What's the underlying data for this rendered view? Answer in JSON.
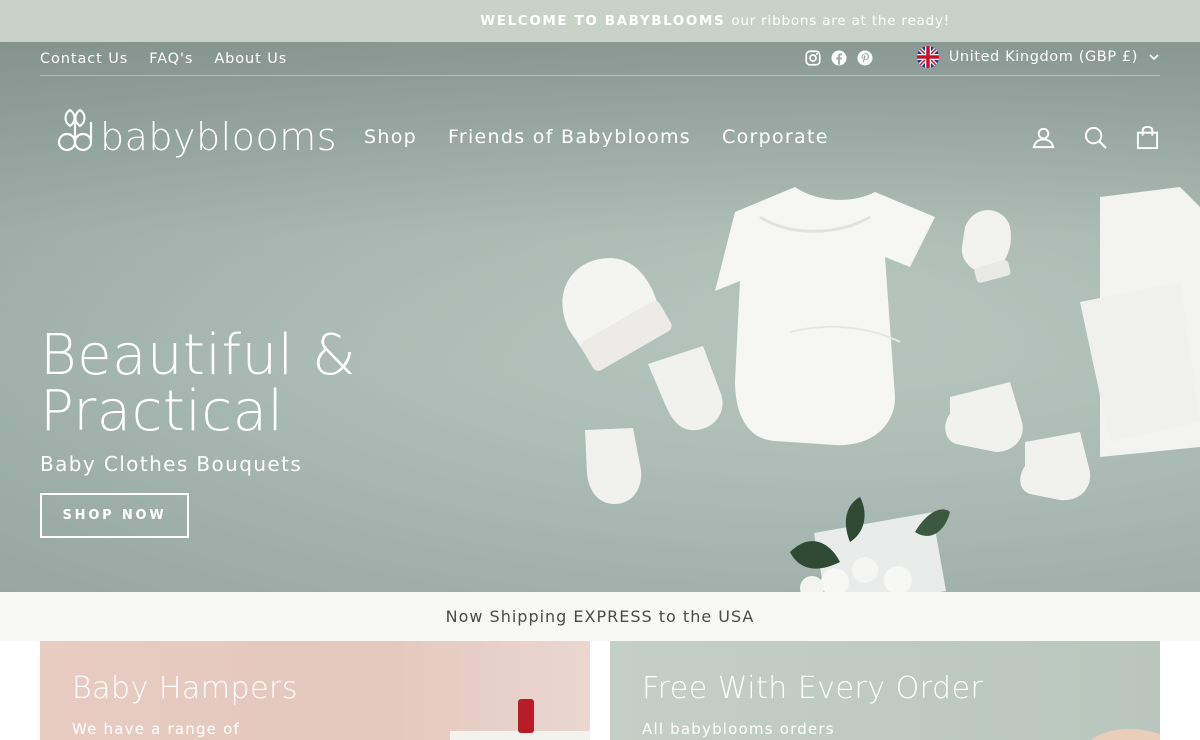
{
  "announcement": {
    "strong": "WELCOME TO BABYBLOOMS",
    "text": "our ribbons are at the ready!"
  },
  "utility_nav": {
    "links": [
      "Contact Us",
      "FAQ's",
      "About Us"
    ],
    "social_icons": [
      "instagram-icon",
      "facebook-icon",
      "pinterest-icon"
    ],
    "currency": "United Kingdom (GBP £)"
  },
  "header": {
    "logo_text": "babyblooms",
    "nav": [
      "Shop",
      "Friends of Babyblooms",
      "Corporate"
    ],
    "icons": [
      "account-icon",
      "search-icon",
      "cart-icon"
    ]
  },
  "hero": {
    "title": "Beautiful & Practical",
    "subtitle": "Baby Clothes Bouquets",
    "button": "SHOP NOW"
  },
  "shipping_bar": "Now Shipping EXPRESS to the USA",
  "promos": [
    {
      "title": "Baby Hampers",
      "text": "We have a range of"
    },
    {
      "title": "Free With Every Order",
      "text": "All babyblooms orders"
    }
  ],
  "colors": {
    "announcement_bg": "#c8d2c8",
    "hero_bg": "#aebdb7",
    "shipbar_bg": "#f8f8f6",
    "promo_left_bg": "#e8cbc1",
    "promo_right_bg": "#c4cfc7"
  }
}
